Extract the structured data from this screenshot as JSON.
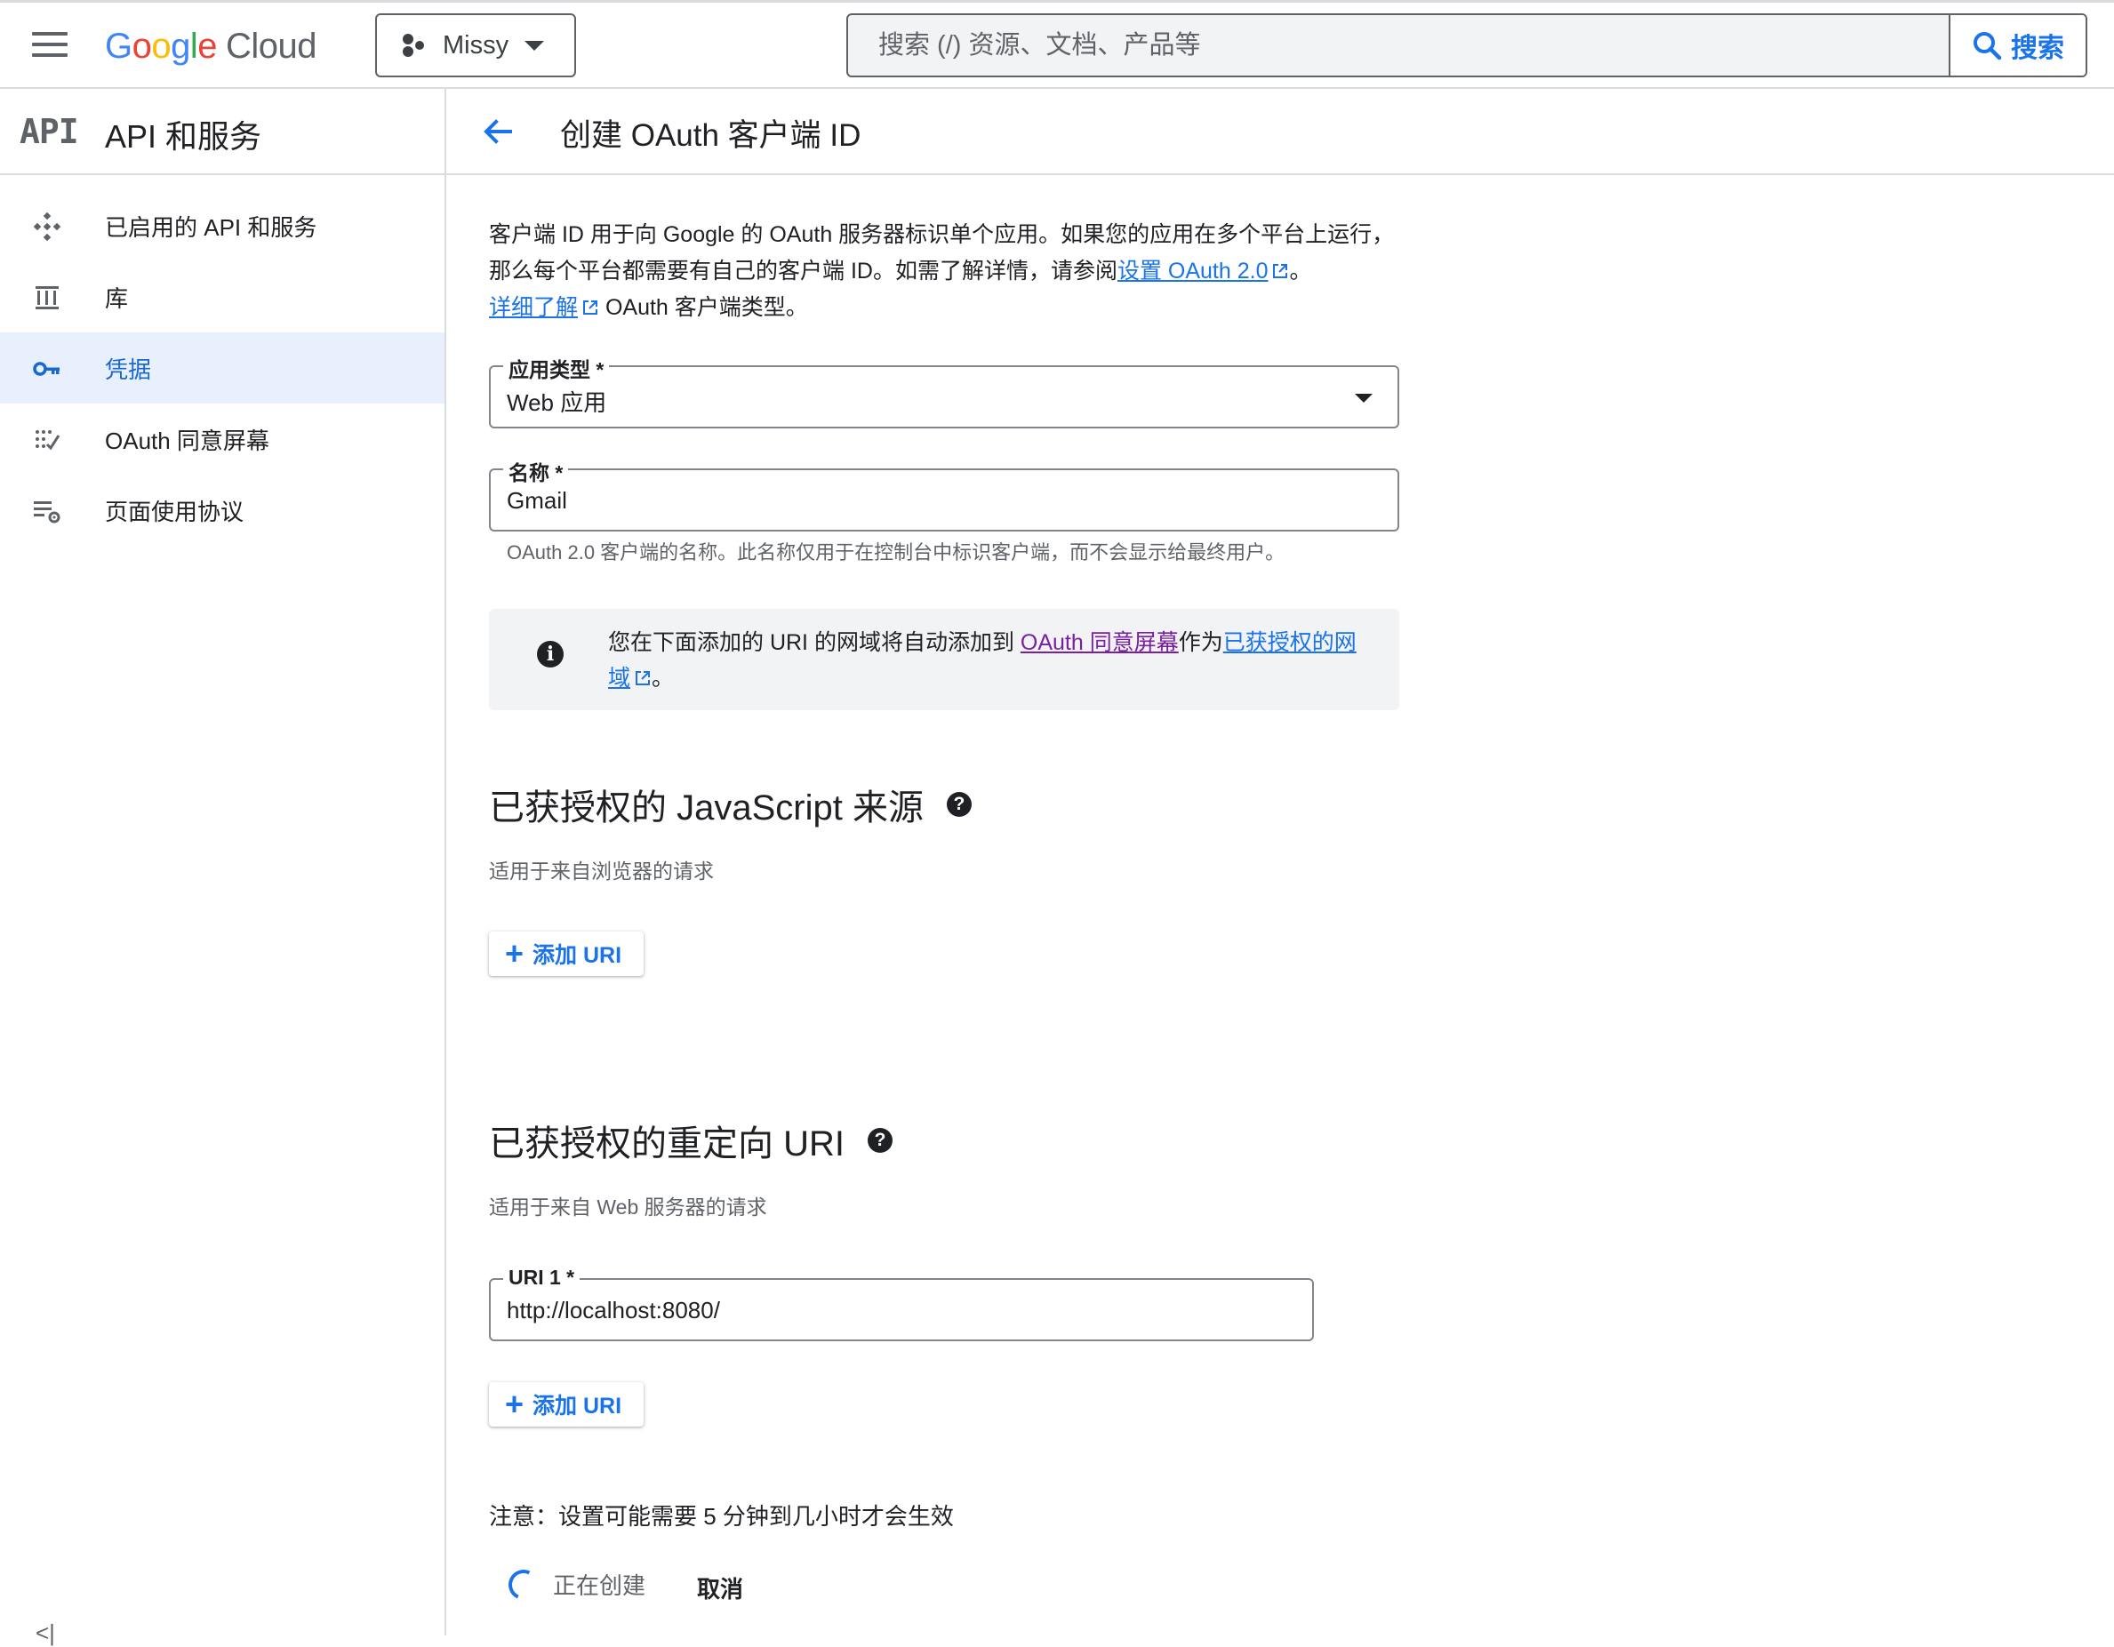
{
  "topbar": {
    "logo_letters": [
      "G",
      "o",
      "o",
      "g",
      "l",
      "e"
    ],
    "logo_cloud": "Cloud",
    "project_name": "Missy",
    "search_placeholder": "搜索 (/) 资源、文档、产品等",
    "search_button_label": "搜索"
  },
  "sidebar": {
    "badge": "API",
    "title": "API 和服务",
    "items": [
      {
        "label": "已启用的 API 和服务",
        "icon": "api-grid-icon",
        "active": false
      },
      {
        "label": "库",
        "icon": "library-icon",
        "active": false
      },
      {
        "label": "凭据",
        "icon": "key-icon",
        "active": true
      },
      {
        "label": "OAuth 同意屏幕",
        "icon": "consent-icon",
        "active": false
      },
      {
        "label": "页面使用协议",
        "icon": "settings-list-icon",
        "active": false
      }
    ],
    "collapse_glyph": "<|"
  },
  "main": {
    "title": "创建 OAuth 客户端 ID",
    "intro": {
      "line1": "客户端 ID 用于向 Google 的 OAuth 服务器标识单个应用。如果您的应用在多个平台上运行，那么每个平台都需要有自己的客户端 ID。如需了解详情，请参阅",
      "link1": "设置 OAuth 2.0",
      "after_link1": "。",
      "link2": "详细了解",
      "after_link2": " OAuth 客户端类型。"
    },
    "app_type": {
      "label": "应用类型 *",
      "value": "Web 应用"
    },
    "name": {
      "label": "名称 *",
      "value": "Gmail",
      "help": "OAuth 2.0 客户端的名称。此名称仅用于在控制台中标识客户端，而不会显示给最终用户。"
    },
    "info": {
      "text1": "您在下面添加的 URI 的网域将自动添加到 ",
      "link1": "OAuth 同意屏幕",
      "text2": "作为",
      "link2": "已获授权的网域",
      "text3": "。"
    },
    "js_origins": {
      "title": "已获授权的 JavaScript 来源",
      "subtitle": "适用于来自浏览器的请求",
      "add_label": "添加 URI"
    },
    "redirect_uris": {
      "title": "已获授权的重定向 URI",
      "subtitle": "适用于来自 Web 服务器的请求",
      "uri_label": "URI 1 *",
      "uri_value": "http://localhost:8080/",
      "add_label": "添加 URI"
    },
    "note": "注意：设置可能需要 5 分钟到几小时才会生效",
    "creating_label": "正在创建",
    "cancel_label": "取消"
  },
  "colors": {
    "accent": "#1a73e8",
    "active_bg": "#e8f0fe",
    "visited_link": "#7b1fa2",
    "info_bg": "#f1f3f4"
  }
}
